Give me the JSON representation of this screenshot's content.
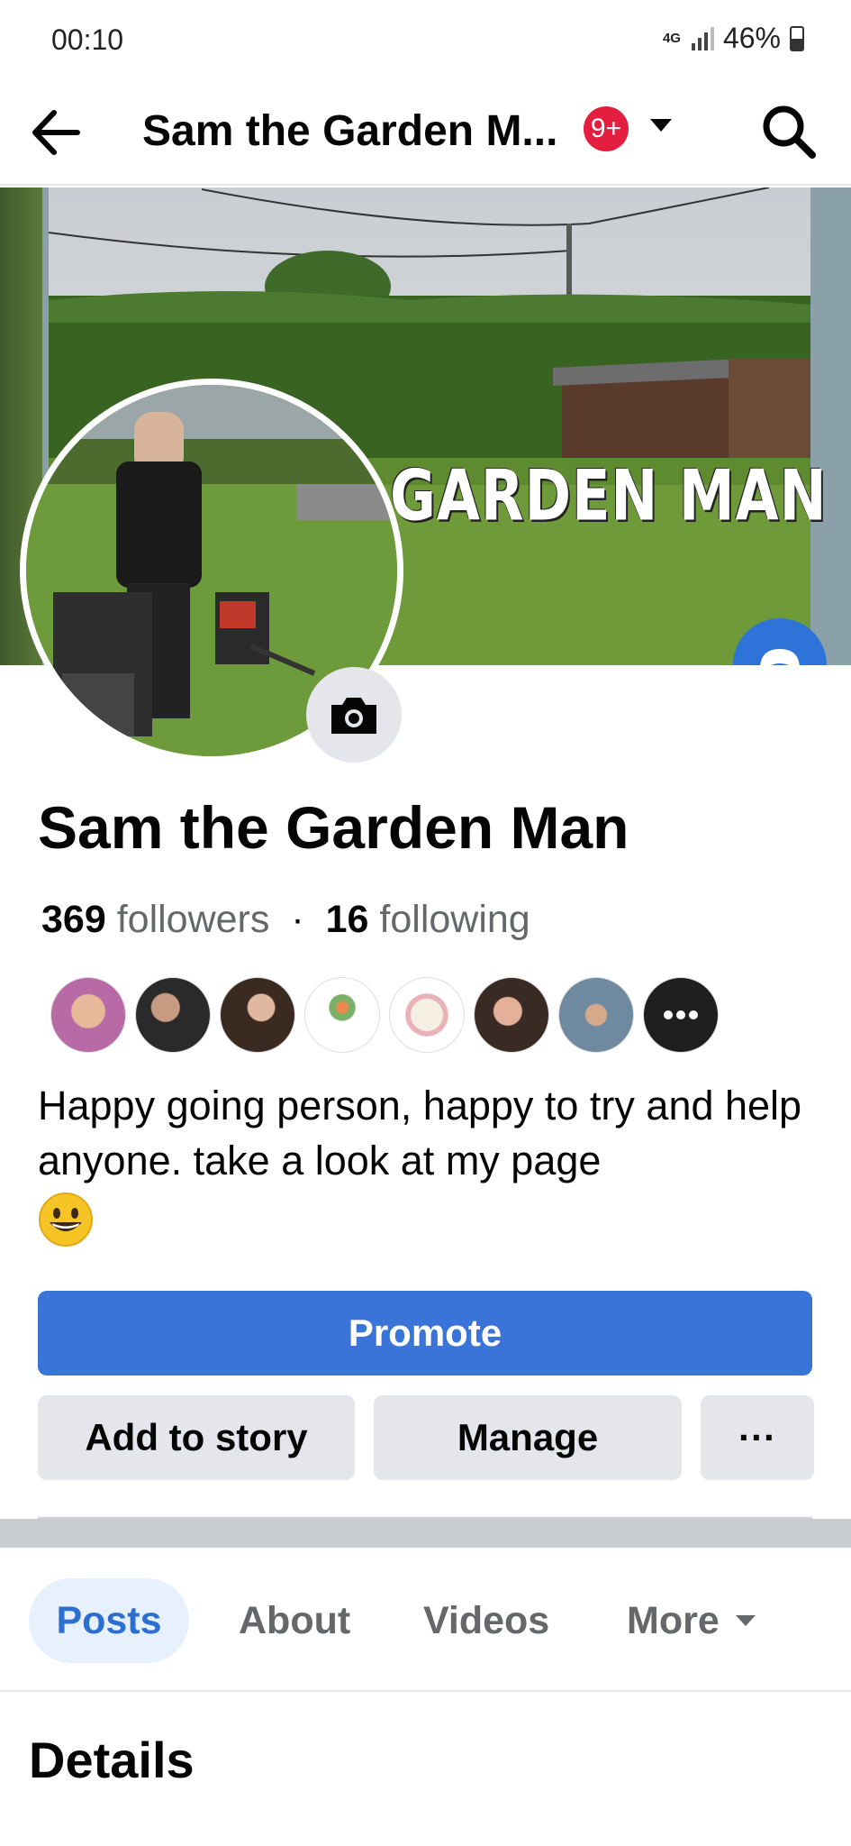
{
  "status_bar": {
    "time": "00:10",
    "network": "4G",
    "battery_percent": "46%"
  },
  "header": {
    "title": "Sam the Garden M...",
    "notification_badge": "9+",
    "back_icon": "arrow-left-icon",
    "search_icon": "search-icon"
  },
  "cover": {
    "overlay_text": "GARDEN MAN"
  },
  "profile": {
    "name": "Sam the Garden Man",
    "followers_count": "369",
    "followers_label": "followers",
    "separator": "·",
    "following_count": "16",
    "following_label": "following",
    "bio": "Happy going person, happy to try and help anyone. take a look at my  page",
    "friend_avatars": [
      "friend-1",
      "friend-2",
      "friend-3",
      "friend-4",
      "friend-5",
      "friend-6",
      "friend-7",
      "friend-more"
    ]
  },
  "actions": {
    "promote": "Promote",
    "add_to_story": "Add to story",
    "manage": "Manage",
    "more": "···"
  },
  "tabs": {
    "posts": "Posts",
    "about": "About",
    "videos": "Videos",
    "more": "More"
  },
  "section": {
    "details": "Details"
  },
  "colors": {
    "accent": "#3b74d9",
    "badge": "#e41e3f",
    "tab_active_bg": "#e7f0fd",
    "tab_active_text": "#2d6fd1",
    "button_grey": "#e4e6eb"
  }
}
